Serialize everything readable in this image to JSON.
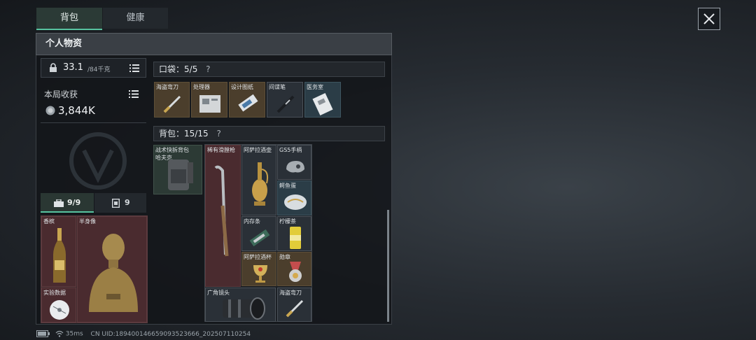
{
  "tabs": {
    "backpack": "背包",
    "health": "健康"
  },
  "header": {
    "title": "个人物资"
  },
  "weight": {
    "current": "33.1",
    "max": "/84千克"
  },
  "haul": {
    "label": "本局收获",
    "value": "3,844K"
  },
  "secure_tabs": {
    "case": "9/9",
    "card": "9"
  },
  "secure_items": [
    {
      "label": "香槟"
    },
    {
      "label": "半身像"
    },
    {
      "label": "实验数据"
    }
  ],
  "pocket": {
    "title": "口袋：",
    "count": "5/5",
    "help": "?",
    "items": [
      {
        "label": "海盗弯刀"
      },
      {
        "label": "处理器"
      },
      {
        "label": "设计图纸"
      },
      {
        "label": "间谍笔"
      },
      {
        "label": "医务室"
      }
    ]
  },
  "bag": {
    "title": "背包：",
    "count": "15/15",
    "help": "?",
    "equipped": {
      "label": "战术快拆背包",
      "sub": "哈夫克"
    },
    "items": [
      {
        "label": "稀有滑膛枪"
      },
      {
        "label": "阿萨拉酒壶"
      },
      {
        "label": "GS5手柄"
      },
      {
        "label": "鳄鱼蛋"
      },
      {
        "label": "内存条"
      },
      {
        "label": "柠檬茶"
      },
      {
        "label": "阿萨拉酒杯"
      },
      {
        "label": "勋章"
      },
      {
        "label": "广角镜头"
      },
      {
        "label": "海盗弯刀"
      }
    ]
  },
  "status": {
    "latency": "35ms",
    "uid": "CN UID:18940014665909352366​6_202507110254"
  }
}
